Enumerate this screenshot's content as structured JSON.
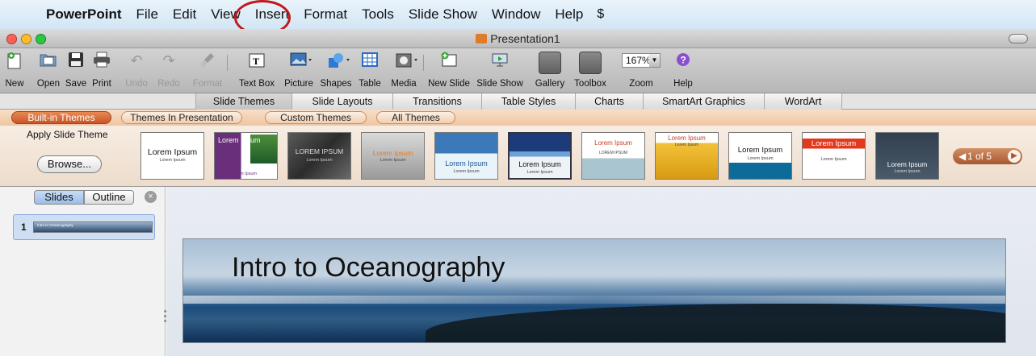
{
  "menubar": {
    "apple_icon": "apple-icon",
    "items": [
      "PowerPoint",
      "File",
      "Edit",
      "View",
      "Insert",
      "Format",
      "Tools",
      "Slide Show",
      "Window",
      "Help"
    ],
    "highlight_color": "#c0191c"
  },
  "window": {
    "title": "Presentation1",
    "traffic_colors": [
      "#ff5f57",
      "#febc2e",
      "#28c840"
    ]
  },
  "toolbar": {
    "new": "New",
    "open": "Open",
    "save": "Save",
    "print": "Print",
    "undo": "Undo",
    "redo": "Redo",
    "format": "Format",
    "text_box": "Text Box",
    "picture": "Picture",
    "shapes": "Shapes",
    "table": "Table",
    "media": "Media",
    "new_slide": "New Slide",
    "slide_show": "Slide Show",
    "gallery": "Gallery",
    "toolbox": "Toolbox",
    "zoom": "Zoom",
    "zoom_value": "167%",
    "help": "Help"
  },
  "ribbon_tabs": [
    "Slide Themes",
    "Slide Layouts",
    "Transitions",
    "Table Styles",
    "Charts",
    "SmartArt Graphics",
    "WordArt"
  ],
  "theme_subtabs": [
    "Built-in Themes",
    "Themes In Presentation",
    "Custom Themes",
    "All Themes"
  ],
  "gallery": {
    "apply_label": "Apply Slide Theme",
    "browse_label": "Browse...",
    "pager": "1 of 5",
    "themes": [
      {
        "title": "Lorem Ipsum",
        "sub": "Lorem Ipsum"
      },
      {
        "title": "Lorem Ipsum",
        "sub": "Lorem Ipsum"
      },
      {
        "title": "LOREM IPSUM",
        "sub": "Lorem Ipsum"
      },
      {
        "title": "Lorem Ipsum",
        "sub": "Lorem Ipsum"
      },
      {
        "title": "Lorem Ipsum",
        "sub": "Lorem Ipsum"
      },
      {
        "title": "Lorem Ipsum",
        "sub": "Lorem Ipsum"
      },
      {
        "title": "Lorem Ipsum",
        "sub": "LOREM IPSUM"
      },
      {
        "title": "Lorem Ipsum",
        "sub": "Lorem Ipsum"
      },
      {
        "title": "Lorem Ipsum",
        "sub": "Lorem Ipsum"
      },
      {
        "title": "Lorem Ipsum",
        "sub": "Lorem Ipsum"
      },
      {
        "title": "Lorem Ipsum",
        "sub": "Lorem Ipsum"
      }
    ]
  },
  "left_pane": {
    "tabs": [
      "Slides",
      "Outline"
    ],
    "slides": [
      {
        "number": "1",
        "title": "Intro to Oceanography"
      }
    ]
  },
  "slide": {
    "title": "Intro to Oceanography"
  }
}
